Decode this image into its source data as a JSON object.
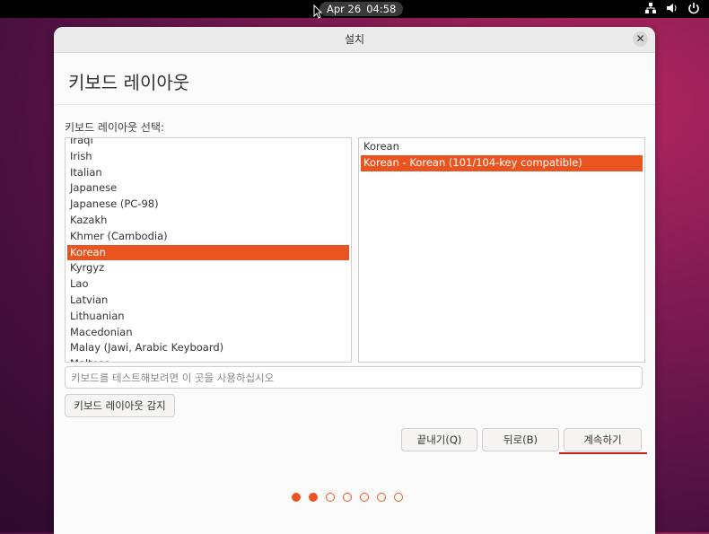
{
  "topbar": {
    "date": "Apr 26",
    "time": "04:58",
    "icons": [
      "network-icon",
      "volume-icon",
      "power-icon"
    ]
  },
  "window": {
    "title": "설치",
    "heading": "키보드 레이아웃",
    "layout_prompt": "키보드 레이아웃 선택:",
    "layouts": [
      "Iraqi",
      "Irish",
      "Italian",
      "Japanese",
      "Japanese (PC-98)",
      "Kazakh",
      "Khmer (Cambodia)",
      "Korean",
      "Kyrgyz",
      "Lao",
      "Latvian",
      "Lithuanian",
      "Macedonian",
      "Malay (Jawi, Arabic Keyboard)",
      "Maltese"
    ],
    "selected_layout": "Korean",
    "variants": [
      "Korean",
      "Korean - Korean (101/104-key compatible)"
    ],
    "selected_variant": "Korean - Korean (101/104-key compatible)",
    "test_placeholder": "키보드를 테스트해보려면 이 곳을 사용하십시오",
    "detect_label": "키보드 레이아웃 감지",
    "quit_label": "끝내기(Q)",
    "back_label": "뒤로(B)",
    "continue_label": "계속하기"
  },
  "progress": {
    "total_steps": 7,
    "completed_steps": 2
  },
  "colors": {
    "accent": "#e95420",
    "highlight": "#d41919"
  }
}
